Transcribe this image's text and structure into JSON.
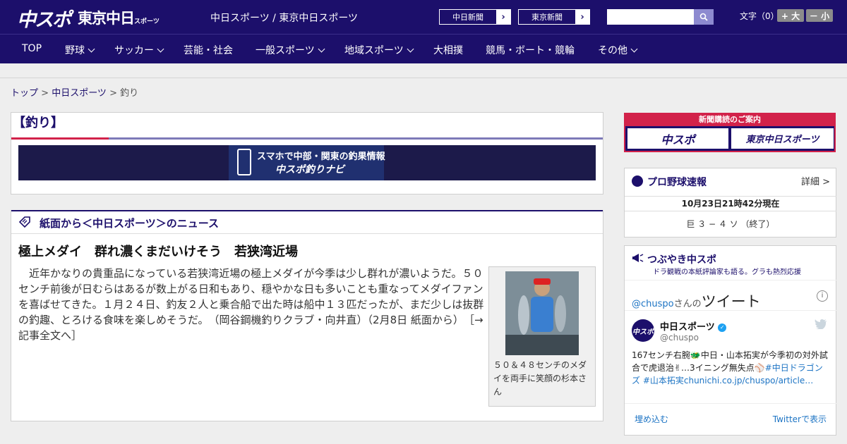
{
  "header": {
    "logo_chuspo": "中スポ",
    "logo_tokyo": "東京中日",
    "logo_tokyo_small": "スポーツ",
    "site_title": "中日スポーツ / 東京中日スポーツ",
    "ext_links": [
      {
        "label": "中日新聞"
      },
      {
        "label": "東京新聞"
      }
    ],
    "search_placeholder": "",
    "font_size_label": "文字（0）",
    "font_bigger": "+ 大",
    "font_smaller": "－ 小"
  },
  "nav": {
    "items": [
      {
        "label": "TOP",
        "dropdown": false
      },
      {
        "label": "野球",
        "dropdown": true
      },
      {
        "label": "サッカー",
        "dropdown": true
      },
      {
        "label": "芸能・社会",
        "dropdown": false
      },
      {
        "label": "一般スポーツ",
        "dropdown": true
      },
      {
        "label": "地域スポーツ",
        "dropdown": true
      },
      {
        "label": "大相撲",
        "dropdown": false
      },
      {
        "label": "競馬・ボート・競輪",
        "dropdown": false
      },
      {
        "label": "その他",
        "dropdown": true
      }
    ]
  },
  "breadcrumb": {
    "home": "トップ",
    "sep": " > ",
    "parent": "中日スポーツ",
    "current": "釣り"
  },
  "category": {
    "title": "【釣り】",
    "banner_line1": "スマホで中部・関東の釣果情報",
    "banner_line2": "中スポ釣りナビ"
  },
  "news": {
    "section_title": "紙面から＜中日スポーツ＞のニュース",
    "article_title": "極上メダイ　群れ濃くまだいけそう　若狭湾近場",
    "article_body": "近年かなりの貴重品になっている若狭湾近場の極上メダイが今季は少し群れが濃いようだ。５０センチ前後が日むらはあるが数上がる日和もあり、穏やかな日も多いことも重なってメダイファンを喜ばせてきた。１月２４日、釣友２人と乗合船で出た時は船中１３匹だったが、まだ少しは抜群の釣趣、とろける食味を楽しめそうだ。　（岡谷鋼機釣りクラブ・向井直）（2月8日 紙面から）",
    "read_more": "［→記事全文へ］",
    "photo_caption": "５０＆４８センチのメダイを両手に笑顔の杉本さん"
  },
  "sidebar": {
    "subscribe_title": "新聞購読のご案内",
    "subscribe_chuspo": "中スポ",
    "subscribe_tokyo": "東京中日スポーツ",
    "baseball": {
      "title": "プロ野球速報",
      "detail": "詳細 >",
      "time": "10月23日21時42分現在",
      "score": "巨 ３ − ４ ソ （終了）"
    },
    "twitter": {
      "title": "つぶやき中スポ",
      "subtitle": "ドラ観戦の本紙評論家も語る。グラも熱烈応援",
      "handle": "@chuspo",
      "handle_suffix": "さんの",
      "tweets_label": "ツイート",
      "account_name": "中日スポーツ",
      "account_id": "@chuspo",
      "avatar_text": "中スポ",
      "tweet_plain": "167センチ右腕🐲中日・山本拓実が今季初の対外試合で虎退治✌…3イニング無失点⚾",
      "tweet_link": "#中日ドラゴンズ #山本拓実chunichi.co.jp/chuspo/article…",
      "embed": "埋め込む",
      "view_on_twitter": "Twitterで表示"
    }
  },
  "colors": {
    "brand_navy": "#1c0f6b",
    "accent_red": "#d2224a",
    "link_blue": "#1d74c4"
  }
}
